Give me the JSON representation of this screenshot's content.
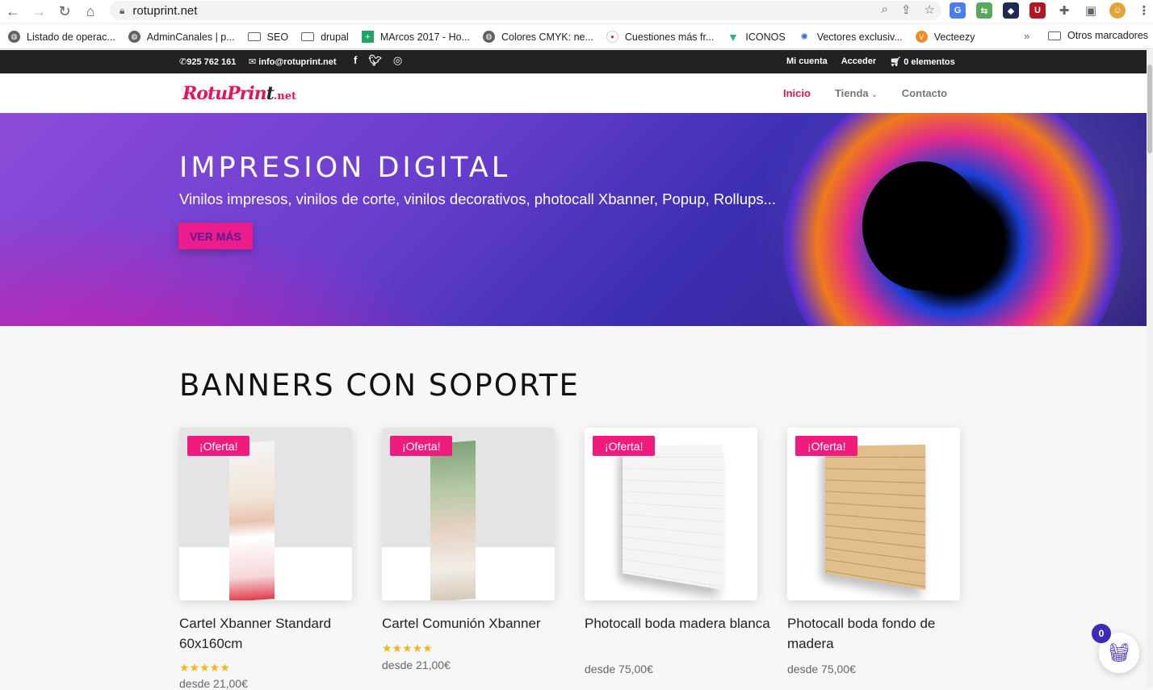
{
  "browser": {
    "url": "rotuprint.net",
    "bookmarks": [
      {
        "label": "Listado de operac...",
        "icon": "globe-icon"
      },
      {
        "label": "AdminCanales | p...",
        "icon": "globe-icon"
      },
      {
        "label": "SEO",
        "icon": "folder-icon"
      },
      {
        "label": "drupal",
        "icon": "folder-icon"
      },
      {
        "label": "MArcos 2017 - Ho...",
        "icon": "sheets-icon"
      },
      {
        "label": "Colores CMYK: ne...",
        "icon": "globe-icon"
      },
      {
        "label": "Cuestiones más fr...",
        "icon": "site-icon"
      },
      {
        "label": "ICONOS",
        "icon": "v-icon"
      },
      {
        "label": "Vectores exclusiv...",
        "icon": "site-icon"
      },
      {
        "label": "Vecteezy",
        "icon": "site-icon"
      }
    ],
    "more": "»",
    "other_bookmarks": "Otros marcadores"
  },
  "topbar": {
    "phone": "925 762 161",
    "email": "info@rotuprint.net",
    "my_account": "Mi cuenta",
    "login": "Acceder",
    "cart": "0 elementos"
  },
  "header": {
    "logo_main": "RotuPrin",
    "logo_t": "t",
    "logo_net": ".net",
    "nav": {
      "home": "Inicio",
      "shop": "Tienda",
      "contact": "Contacto"
    }
  },
  "hero": {
    "title": "IMPRESION DIGITAL",
    "subtitle": "Vinilos impresos, vinilos de corte, vinilos decorativos, photocall Xbanner, Popup, Rollups...",
    "button": "VER MÁS"
  },
  "section": {
    "title": "BANNERS CON SOPORTE"
  },
  "products": [
    {
      "badge": "¡Oferta!",
      "name": "Cartel Xbanner Standard 60x160cm",
      "rating": 5,
      "price": "desde 21,00€"
    },
    {
      "badge": "¡Oferta!",
      "name": "Cartel Comunión Xbanner",
      "rating": 5,
      "price": "desde 21,00€"
    },
    {
      "badge": "¡Oferta!",
      "name": "Photocall boda madera blanca",
      "rating": null,
      "price": "desde 75,00€"
    },
    {
      "badge": "¡Oferta!",
      "name": "Photocall boda fondo de madera",
      "rating": null,
      "price": "desde 75,00€"
    }
  ],
  "floating_cart": {
    "count": "0"
  },
  "colors": {
    "accent": "#e5135c",
    "badge": "#ef1c7d",
    "button": "#ec1c8d",
    "cart": "#3b2bb5"
  }
}
